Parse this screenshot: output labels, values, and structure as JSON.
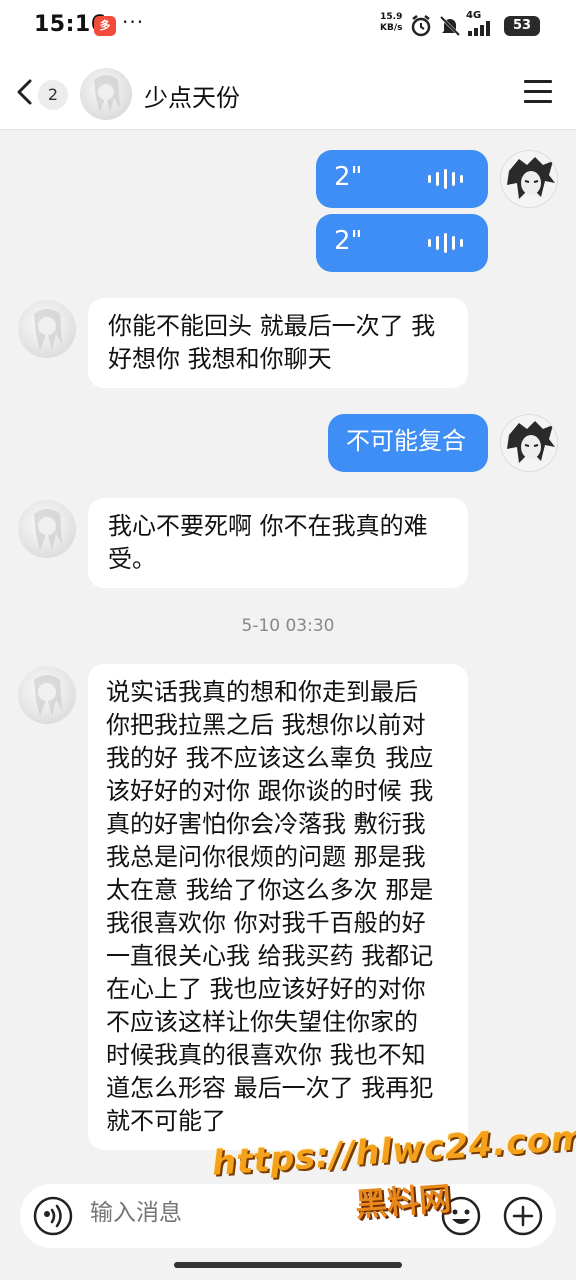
{
  "status_bar": {
    "time": "15:16",
    "app_badge": "多",
    "dots": "···",
    "net_speed_value": "15.9",
    "net_speed_unit": "KB/s",
    "network": "4G",
    "battery": "53"
  },
  "header": {
    "unread_count": "2",
    "contact_name": "少点天份"
  },
  "messages": [
    {
      "from": "self",
      "type": "voice",
      "duration": "2\""
    },
    {
      "from": "self",
      "type": "voice",
      "duration": "2\""
    },
    {
      "from": "other",
      "type": "text",
      "lines": [
        "你能不能回头 就最后一次了 我",
        "好想你 我想和你聊天"
      ]
    },
    {
      "from": "self",
      "type": "text",
      "text": "不可能复合"
    },
    {
      "from": "other",
      "type": "text",
      "lines": [
        "我心不要死啊 你不在我真的难",
        "受。"
      ]
    },
    {
      "from": "other",
      "type": "text",
      "lines": [
        "说实话我真的想和你走到最后",
        "你把我拉黑之后 我想你以前对",
        "我的好 我不应该这么辜负 我应",
        "该好好的对你 跟你谈的时候 我",
        "真的好害怕你会冷落我 敷衍我",
        "我总是问你很烦的问题 那是我",
        "太在意 我给了你这么多次 那是",
        "我很喜欢你 你对我千百般的好",
        "一直很关心我 给我买药 我都记",
        "在心上了 我也应该好好的对你",
        "不应该这样让你失望住你家的",
        "时候我真的很喜欢你 我也不知",
        "道怎么形容 最后一次了 我再犯",
        "就不可能了"
      ]
    }
  ],
  "timestamp": "5-10 03:30",
  "input_bar": {
    "placeholder": "输入消息"
  },
  "watermark": {
    "url": "https://hlwc24.com",
    "name": "黑料网"
  },
  "colors": {
    "outgoing_bubble": "#3f8ef5",
    "incoming_bubble": "#ffffff",
    "background": "#f2f2f2"
  }
}
